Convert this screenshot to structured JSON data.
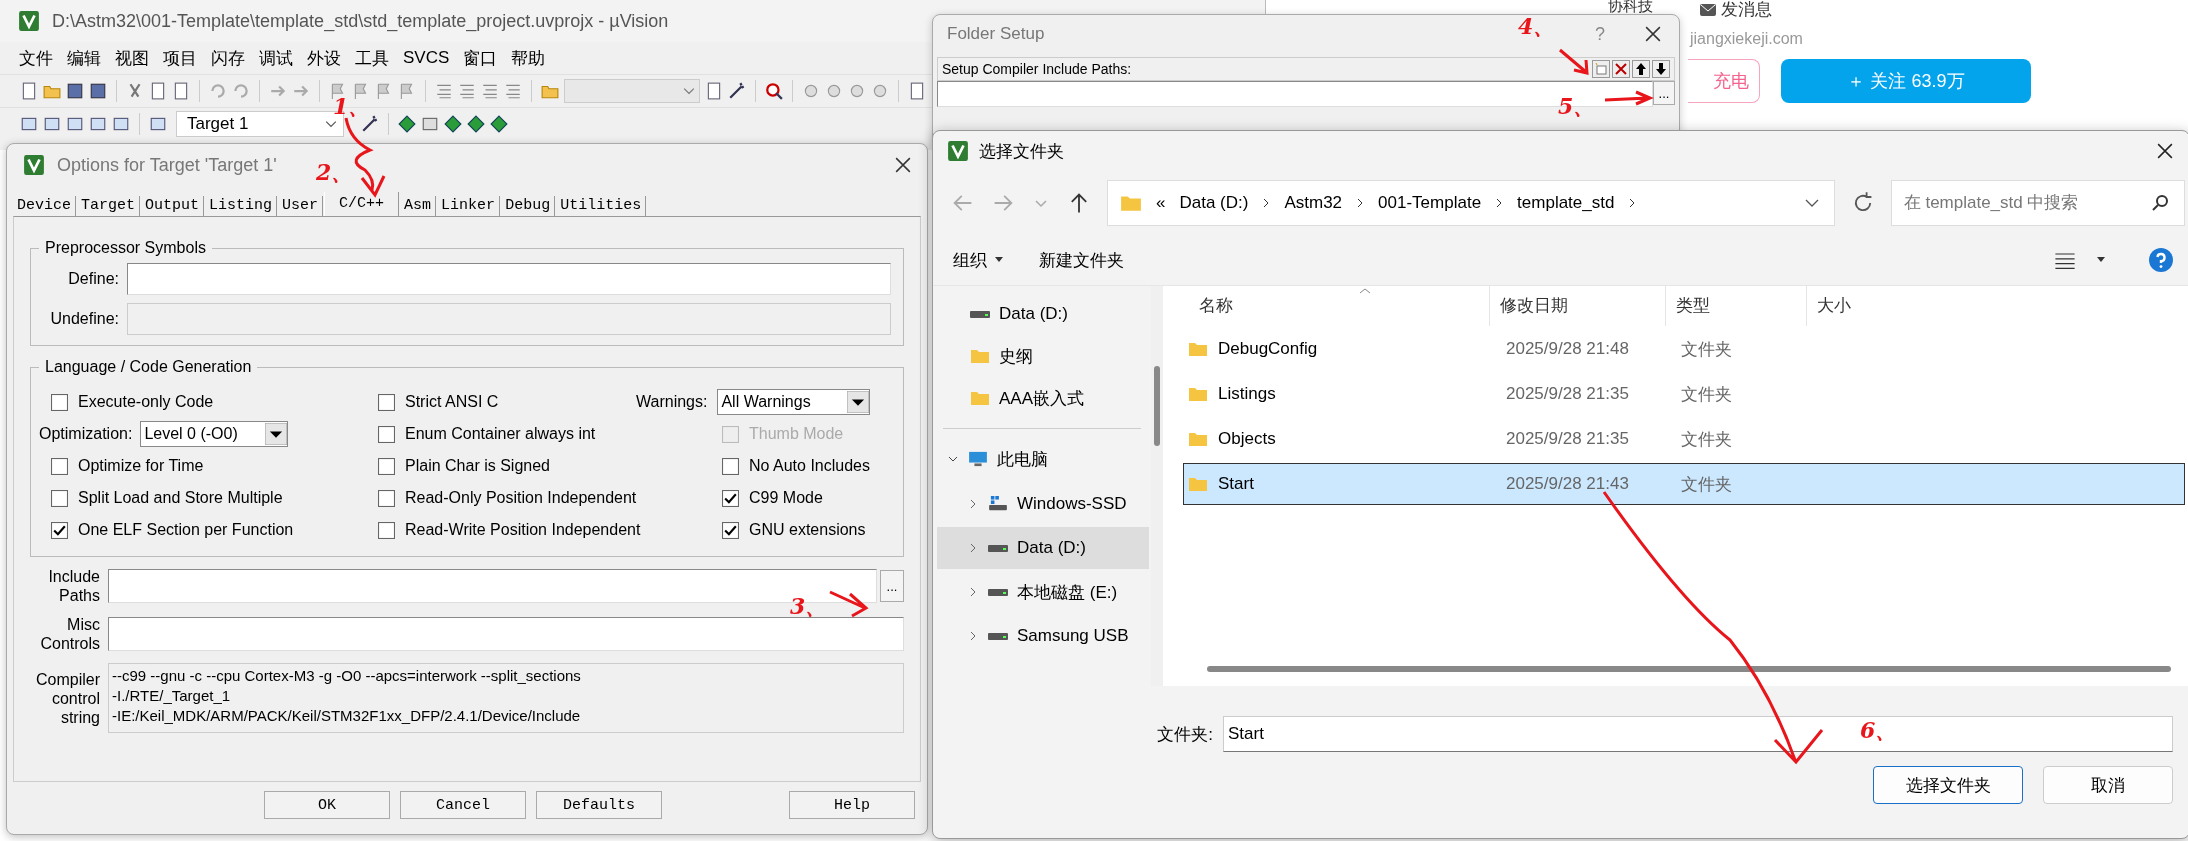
{
  "main_window": {
    "title": "D:\\Astm32\\001-Template\\template_std\\std_template_project.uvprojx - µVision",
    "menu": [
      "文件",
      "编辑",
      "视图",
      "项目",
      "闪存",
      "调试",
      "外设",
      "工具",
      "SVCS",
      "窗口",
      "帮助"
    ],
    "target_select": {
      "value": "Target 1"
    }
  },
  "options_dialog": {
    "title": "Options for Target 'Target 1'",
    "tabs": [
      {
        "label": "Device",
        "selected": false
      },
      {
        "label": "Target",
        "selected": false
      },
      {
        "label": "Output",
        "selected": false
      },
      {
        "label": "Listing",
        "selected": false
      },
      {
        "label": "User",
        "selected": false
      },
      {
        "label": "C/C++",
        "selected": true
      },
      {
        "label": "Asm",
        "selected": false
      },
      {
        "label": "Linker",
        "selected": false
      },
      {
        "label": "Debug",
        "selected": false
      },
      {
        "label": "Utilities",
        "selected": false
      }
    ],
    "preprocessor": {
      "title": "Preprocessor Symbols",
      "fields": [
        {
          "label": "Define:",
          "disabled": false
        },
        {
          "label": "Undefine:",
          "disabled": true
        }
      ]
    },
    "language": {
      "title": "Language / Code Generation",
      "columns": [
        [
          {
            "kind": "checkbox",
            "label": "Execute-only Code",
            "checked": false,
            "disabled": false
          },
          {
            "kind": "select",
            "label": "Optimization:",
            "value": "Level 0 (-O0)"
          },
          {
            "kind": "checkbox",
            "label": "Optimize for Time",
            "checked": false,
            "disabled": false
          },
          {
            "kind": "checkbox",
            "label": "Split Load and Store Multiple",
            "checked": false,
            "disabled": false
          },
          {
            "kind": "checkbox",
            "label": "One ELF Section per Function",
            "checked": true,
            "disabled": false
          }
        ],
        [
          {
            "kind": "checkbox",
            "label": "Strict ANSI C",
            "checked": false,
            "disabled": false
          },
          {
            "kind": "checkbox",
            "label": "Enum Container always int",
            "checked": false,
            "disabled": false
          },
          {
            "kind": "checkbox",
            "label": "Plain Char is Signed",
            "checked": false,
            "disabled": false
          },
          {
            "kind": "checkbox",
            "label": "Read-Only Position Independent",
            "checked": false,
            "disabled": false
          },
          {
            "kind": "checkbox",
            "label": "Read-Write Position Independent",
            "checked": false,
            "disabled": false
          }
        ],
        [
          {
            "kind": "select",
            "label": "Warnings:",
            "value": "All Warnings"
          },
          {
            "kind": "checkbox",
            "label": "Thumb Mode",
            "checked": false,
            "disabled": true
          },
          {
            "kind": "checkbox",
            "label": "No Auto Includes",
            "checked": false,
            "disabled": false
          },
          {
            "kind": "checkbox",
            "label": "C99 Mode",
            "checked": true,
            "disabled": false
          },
          {
            "kind": "checkbox",
            "label": "GNU extensions",
            "checked": true,
            "disabled": false
          }
        ]
      ]
    },
    "include_paths": {
      "label": "Include Paths",
      "browse": "..."
    },
    "misc_controls": {
      "label": "Misc Controls"
    },
    "compiler_string": {
      "label": "Compiler control string",
      "lines": [
        "--c99 --gnu -c --cpu Cortex-M3 -g -O0 --apcs=interwork --split_sections",
        "-I./RTE/_Target_1",
        "-IE:/Keil_MDK/ARM/PACK/Keil/STM32F1xx_DFP/2.4.1/Device/Include"
      ]
    },
    "buttons": [
      "OK",
      "Cancel",
      "Defaults",
      "Help"
    ]
  },
  "folder_setup": {
    "title": "Folder Setup",
    "help": "?",
    "label": "Setup Compiler Include Paths:",
    "browse": "..."
  },
  "web_page": {
    "site_title": "协科技",
    "message": "发消息",
    "domain": "jiangxiekeji.com",
    "charge_button": "充电",
    "follow_button": "＋ 关注 63.9万"
  },
  "file_dialog": {
    "title": "选择文件夹",
    "breadcrumb": [
      "«",
      "Data (D:)",
      "Astm32",
      "001-Template",
      "template_std"
    ],
    "search": {
      "placeholder": "在 template_std 中搜索"
    },
    "toolbar": {
      "organize": "组织",
      "new_folder": "新建文件夹"
    },
    "nav": {
      "pinned": [
        {
          "kind": "drive",
          "label": "Data (D:)",
          "selected": false
        },
        {
          "kind": "folder",
          "label": "史纲",
          "selected": false
        },
        {
          "kind": "folder",
          "label": "AAA嵌入式",
          "selected": false
        }
      ],
      "tree": [
        {
          "kind": "pc",
          "label": "此电脑",
          "expanded": true,
          "selected": false,
          "children": [
            {
              "kind": "windows-drive",
              "label": "Windows-SSD",
              "expanded": false,
              "selected": false
            },
            {
              "kind": "drive",
              "label": "Data (D:)",
              "expanded": false,
              "selected": true
            },
            {
              "kind": "drive",
              "label": "本地磁盘 (E:)",
              "expanded": false,
              "selected": false
            },
            {
              "kind": "drive",
              "label": "Samsung USB",
              "expanded": false,
              "selected": false
            }
          ]
        }
      ]
    },
    "columns": [
      "名称",
      "修改日期",
      "类型",
      "大小"
    ],
    "rows": [
      {
        "name": "DebugConfig",
        "date": "2025/9/28 21:48",
        "type": "文件夹",
        "selected": false
      },
      {
        "name": "Listings",
        "date": "2025/9/28 21:35",
        "type": "文件夹",
        "selected": false
      },
      {
        "name": "Objects",
        "date": "2025/9/28 21:35",
        "type": "文件夹",
        "selected": false
      },
      {
        "name": "Start",
        "date": "2025/9/28 21:43",
        "type": "文件夹",
        "selected": true
      }
    ],
    "folder_field": {
      "label": "文件夹:",
      "value": "Start"
    },
    "buttons": [
      "选择文件夹",
      "取消"
    ]
  },
  "annotations": [
    {
      "label": "1、"
    },
    {
      "label": "2、"
    },
    {
      "label": "3、"
    },
    {
      "label": "4、"
    },
    {
      "label": "5、"
    },
    {
      "label": "6、"
    }
  ]
}
